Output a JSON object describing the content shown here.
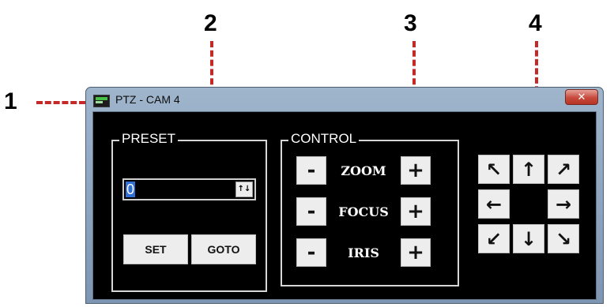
{
  "callouts": [
    "1",
    "2",
    "3",
    "4"
  ],
  "window": {
    "title": "PTZ - CAM 4",
    "close_icon": "close-icon",
    "app_icon": "camera-app-icon"
  },
  "preset": {
    "group_label": "PRESET",
    "value": "0",
    "spinner_symbol": "↑↓",
    "set_label": "SET",
    "goto_label": "GOTO"
  },
  "control": {
    "group_label": "CONTROL",
    "rows": [
      {
        "minus": "-",
        "label": "ZOOM",
        "plus": "+"
      },
      {
        "minus": "-",
        "label": "FOCUS",
        "plus": "+"
      },
      {
        "minus": "-",
        "label": "IRIS",
        "plus": "+"
      }
    ]
  },
  "pantilt": {
    "up_left": "↖",
    "up": "↑",
    "up_right": "↗",
    "left": "←",
    "right": "→",
    "down_left": "↙",
    "down": "↓",
    "down_right": "↘"
  },
  "colors": {
    "callout_line": "#c62828",
    "client_bg": "#000000",
    "button_bg": "#ededed"
  }
}
